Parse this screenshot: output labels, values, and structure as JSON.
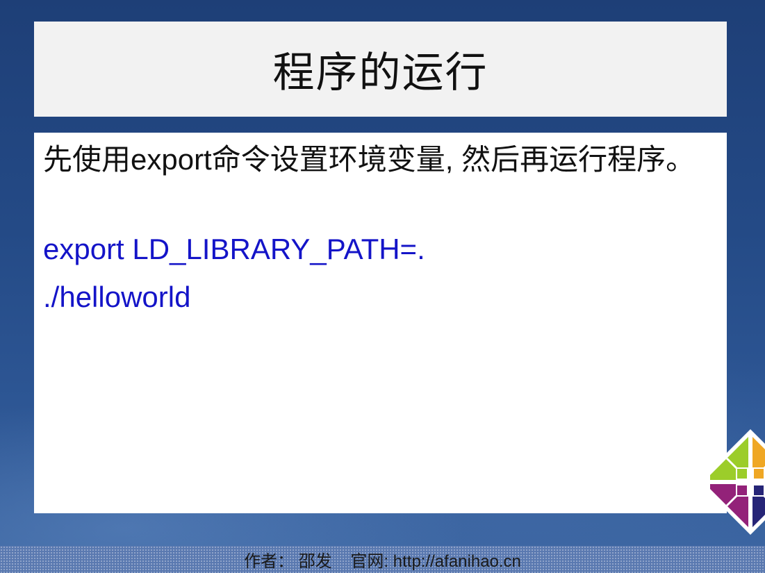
{
  "slide": {
    "title": "程序的运行",
    "body_text": "先使用export命令设置环境变量, 然后再运行程序。",
    "code_lines": [
      "export LD_LIBRARY_PATH=.",
      "./helloworld"
    ],
    "footer": "作者： 邵发    官网: http://afanihao.cn"
  },
  "logo": {
    "icon": "centos-logo-icon",
    "colors": [
      "#9ccd2a",
      "#932279",
      "#efa724",
      "#262577"
    ]
  },
  "colors": {
    "background": "#244a86",
    "title_box": "#f2f2f2",
    "code_text": "#1414c8"
  }
}
